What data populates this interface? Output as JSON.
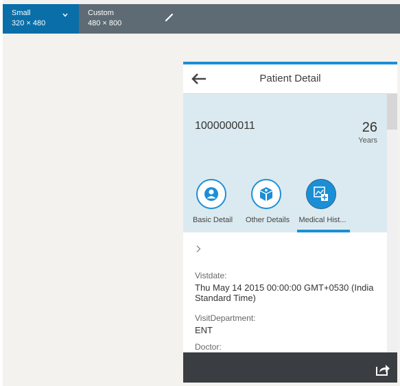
{
  "device_bar": {
    "options": [
      {
        "name": "Small",
        "size": "320 × 480",
        "selected": true
      },
      {
        "name": "Custom",
        "size": "480 × 800",
        "selected": false
      }
    ]
  },
  "phone": {
    "title": "Patient Detail",
    "header": {
      "id": "1000000011",
      "age_number": "26",
      "age_unit": "Years"
    },
    "tabs": [
      {
        "label": "Basic Detail",
        "icon": "user-icon",
        "selected": false
      },
      {
        "label": "Other Details",
        "icon": "box-icon",
        "selected": false
      },
      {
        "label": "Medical Hist...",
        "icon": "medical-image-icon",
        "selected": true
      }
    ],
    "fields": [
      {
        "label": "Vistdate:",
        "value": "Thu May 14 2015 00:00:00 GMT+0530 (India Standard Time)"
      },
      {
        "label": "VisitDepartment:",
        "value": "ENT"
      },
      {
        "label": "Doctor:",
        "value": ""
      }
    ]
  },
  "colors": {
    "accent": "#1b8fd6",
    "device_bar": "#5e6b75",
    "device_selected": "#0a6ea8",
    "header_bg": "#dbeaf0",
    "footer_bg": "#3a3e42"
  }
}
